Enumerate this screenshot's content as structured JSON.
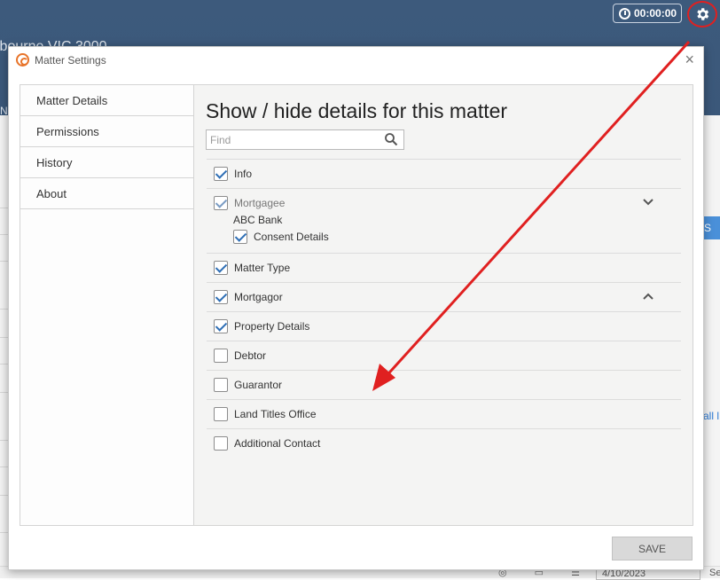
{
  "background": {
    "address_fragment": "lbourne VIC 3000",
    "side_letter": "N",
    "timer": "00:00:00",
    "right_tab_letter": "S",
    "right_link_fragment": "all l",
    "footer_date": "4/10/2023",
    "footer_side_text": "Se"
  },
  "dialog": {
    "title": "Matter Settings",
    "close_label": "×",
    "heading": "Show / hide details for this matter",
    "find_placeholder": "Find",
    "save_label": "SAVE"
  },
  "sidebar": {
    "items": [
      {
        "label": "Matter Details"
      },
      {
        "label": "Permissions"
      },
      {
        "label": "History"
      },
      {
        "label": "About"
      }
    ]
  },
  "details": {
    "info": {
      "label": "Info",
      "checked": true
    },
    "mortgagee": {
      "label": "Mortgagee",
      "checked": true,
      "disabled": true,
      "expanded": true,
      "sub_title": "ABC Bank",
      "sub_item": {
        "label": "Consent Details",
        "checked": true
      }
    },
    "matter_type": {
      "label": "Matter Type",
      "checked": true
    },
    "mortgagor": {
      "label": "Mortgagor",
      "checked": true,
      "expanded": false
    },
    "property_details": {
      "label": "Property Details",
      "checked": true
    },
    "debtor": {
      "label": "Debtor",
      "checked": false
    },
    "guarantor": {
      "label": "Guarantor",
      "checked": false
    },
    "land_titles_office": {
      "label": "Land Titles Office",
      "checked": false
    },
    "additional_contact": {
      "label": "Additional Contact",
      "checked": false
    }
  },
  "colors": {
    "header_bg": "#3d5a7c",
    "checkbox_tick": "#2f6fb5",
    "annotation": "#e02020",
    "brand": "#e8742a"
  },
  "icons": {
    "timer": "clock-icon",
    "settings": "gear-icon",
    "search": "search-icon",
    "expand": "chevron-down-icon",
    "collapse": "chevron-up-icon",
    "close": "close-icon"
  }
}
